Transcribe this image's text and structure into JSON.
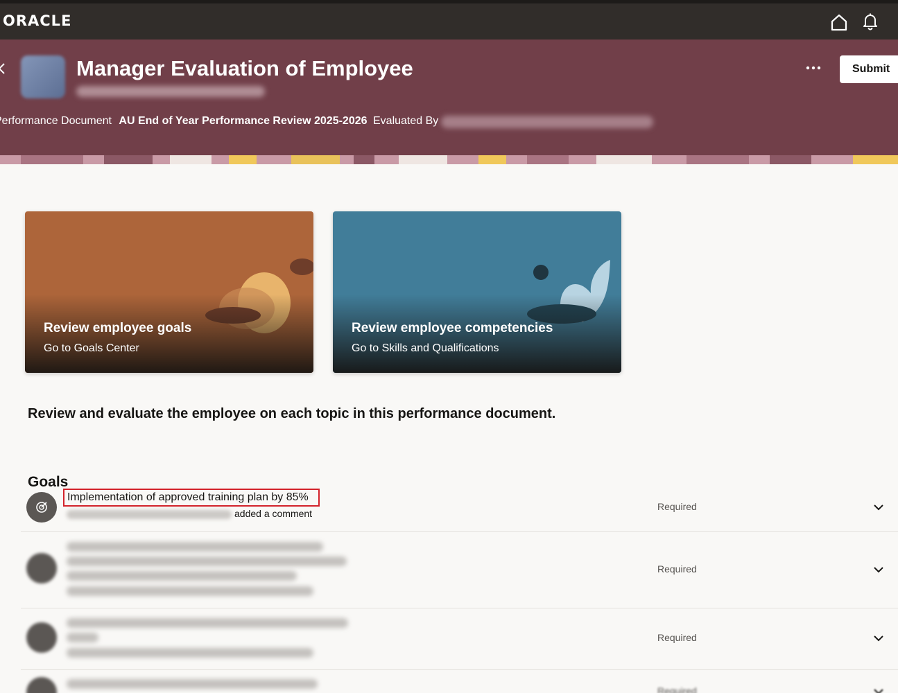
{
  "app": {
    "brand": "ORACLE"
  },
  "header": {
    "title": "Manager Evaluation of Employee",
    "submit_label": "Submit",
    "performance_document_label": "Performance Document",
    "performance_document_value": "AU End of Year Performance Review 2025-2026",
    "evaluated_by_label": "Evaluated By",
    "colors": {
      "band": "#713f49",
      "topbar": "#312d2a"
    }
  },
  "cards": [
    {
      "title": "Review employee goals",
      "subtitle": "Go to Goals Center",
      "color": "#ad653a"
    },
    {
      "title": "Review employee competencies",
      "subtitle": "Go to Skills and Qualifications",
      "color": "#417d99"
    }
  ],
  "instructions": "Review and evaluate the employee on each topic in this performance document.",
  "goals": {
    "heading": "Goals",
    "items": [
      {
        "title": "Implementation of approved training plan by 85%",
        "comment_suffix": "added a comment",
        "status": "Required"
      },
      {
        "status": "Required"
      },
      {
        "status": "Required"
      },
      {
        "status": "Required"
      }
    ]
  },
  "icons": [
    "back-icon",
    "home-icon",
    "bell-icon",
    "more-icon",
    "target-icon",
    "chevron-down-icon"
  ]
}
